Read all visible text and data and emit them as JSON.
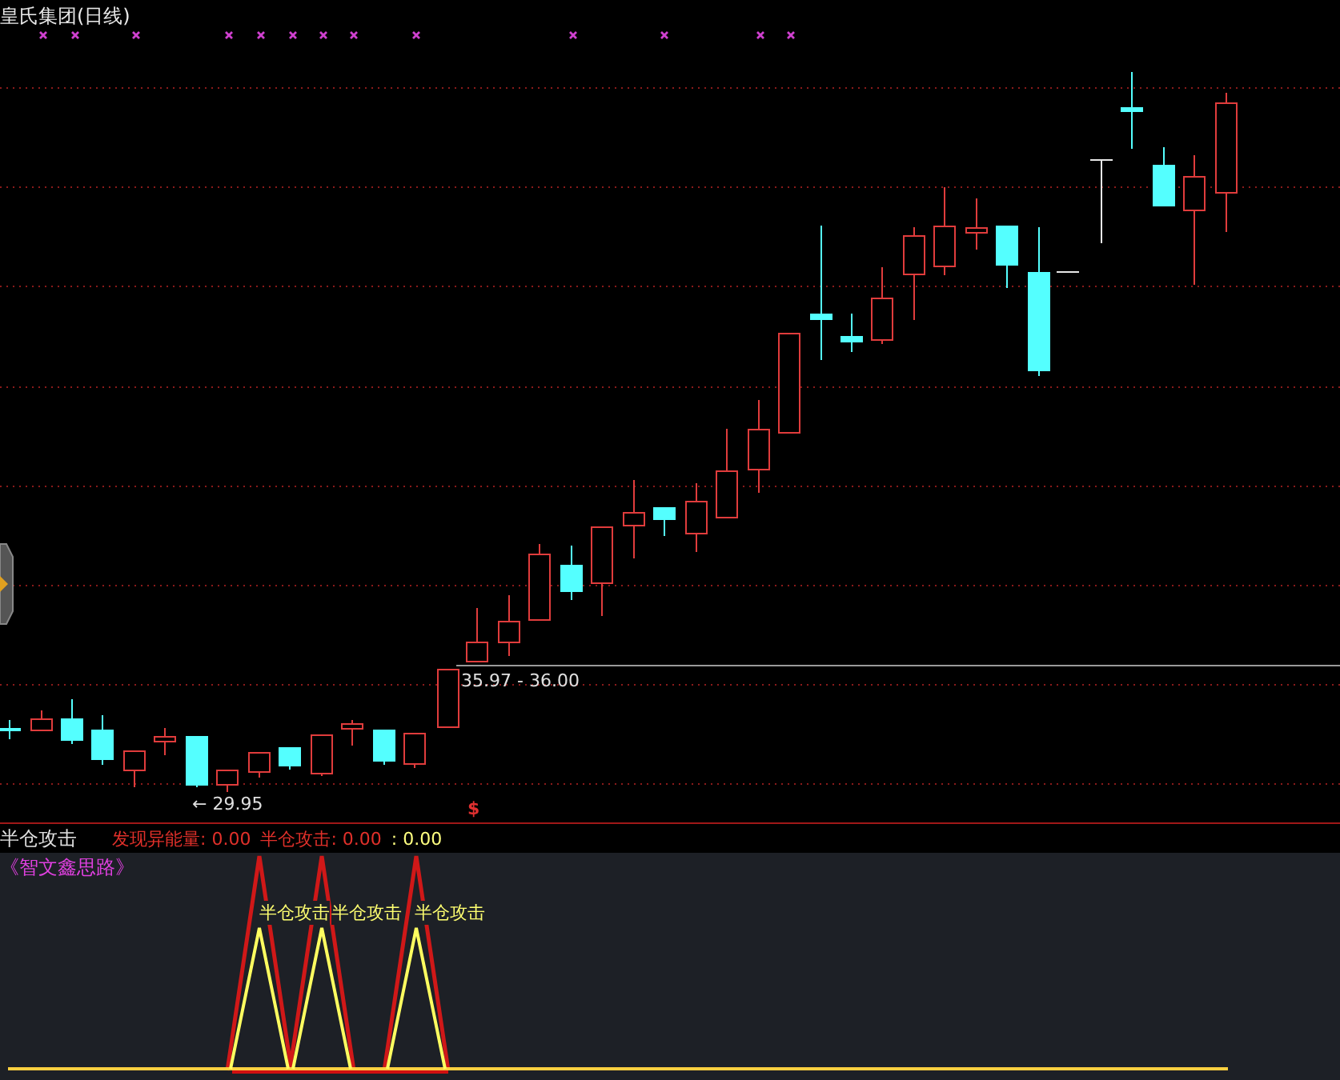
{
  "price_panel": {
    "title": "皇氏集团(日线)",
    "high_label": "35.97 - 36.00",
    "low_label": "← 29.95",
    "signal_mark": "$"
  },
  "indicator_header": {
    "name": "半仓攻击",
    "legend": [
      {
        "text": "发现异能量: 0.00",
        "color": "#e0302a"
      },
      {
        "text": "半仓攻击: 0.00",
        "color": "#e0302a"
      },
      {
        "text": ": 0.00",
        "color": "#ffff80"
      }
    ]
  },
  "indicator_panel": {
    "subtitle": "《智文鑫思路》",
    "signal_labels": [
      "半仓攻击",
      "半仓攻击",
      "半仓攻击"
    ]
  }
}
